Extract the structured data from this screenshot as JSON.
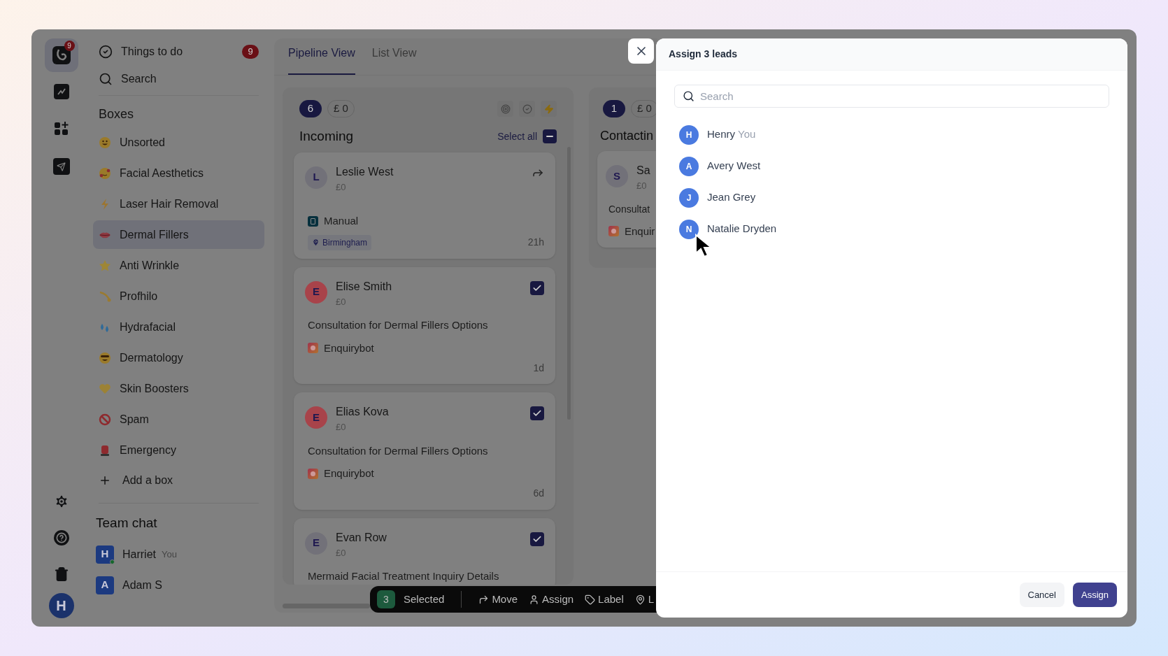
{
  "rail": {
    "logo_badge": "9"
  },
  "sidebar": {
    "things_to_do": {
      "label": "Things to do",
      "count": "9"
    },
    "search": {
      "label": "Search"
    },
    "boxes_title": "Boxes",
    "boxes": [
      {
        "label": "Unsorted",
        "selected": false
      },
      {
        "label": "Facial Aesthetics",
        "selected": false
      },
      {
        "label": "Laser Hair Removal",
        "selected": false
      },
      {
        "label": "Dermal Fillers",
        "selected": true
      },
      {
        "label": "Anti Wrinkle",
        "selected": false
      },
      {
        "label": "Profhilo",
        "selected": false
      },
      {
        "label": "Hydrafacial",
        "selected": false
      },
      {
        "label": "Dermatology",
        "selected": false
      },
      {
        "label": "Skin Boosters",
        "selected": false
      },
      {
        "label": "Spam",
        "selected": false
      },
      {
        "label": "Emergency",
        "selected": false
      }
    ],
    "add_box": "Add a box",
    "team_chat_title": "Team chat",
    "team": [
      {
        "initial": "H",
        "name": "Harriet",
        "tag": "You",
        "online": true
      },
      {
        "initial": "A",
        "name": "Adam S",
        "online": false
      }
    ],
    "user_initial": "H"
  },
  "tabs": [
    {
      "label": "Pipeline View",
      "selected": true
    },
    {
      "label": "List View",
      "selected": false
    }
  ],
  "columns": [
    {
      "count": "6",
      "value": "£ 0",
      "title": "Incoming",
      "select_all": {
        "label": "Select all",
        "indeterminate": true
      },
      "cards": [
        {
          "initial": "L",
          "color": "#727179",
          "name": "Leslie West",
          "amount": "£0",
          "checked": false,
          "source": {
            "label": "Manual",
            "kind": "manual"
          },
          "location": "Birmingham",
          "time": "21h"
        },
        {
          "initial": "E",
          "color": "#a8434a",
          "name": "Elise Smith",
          "amount": "£0",
          "checked": true,
          "title": "Consultation for Dermal Fillers Options",
          "source": {
            "label": "Enquirybot",
            "kind": "bot"
          },
          "time": "1d"
        },
        {
          "initial": "E",
          "color": "#a8434a",
          "name": "Elias Kova",
          "amount": "£0",
          "checked": true,
          "title": "Consultation for Dermal Fillers Options",
          "source": {
            "label": "Enquirybot",
            "kind": "bot"
          },
          "time": "6d"
        },
        {
          "initial": "E",
          "color": "#727179",
          "name": "Evan Row",
          "amount": "£0",
          "checked": true,
          "title": "Mermaid Facial Treatment Inquiry Details"
        }
      ]
    },
    {
      "count": "1",
      "value": "£ 0",
      "title": "Contactin",
      "cards": [
        {
          "initial": "S",
          "color": "#727179",
          "name": "Sa",
          "amount": "£0",
          "title": "Consultat",
          "source": {
            "label": "Enquir",
            "kind": "bot"
          }
        }
      ]
    }
  ],
  "action_bar": {
    "count": "3",
    "label": "Selected",
    "actions": [
      {
        "label": "Move",
        "kind": "move"
      },
      {
        "label": "Assign",
        "kind": "assign"
      },
      {
        "label": "Label",
        "kind": "label"
      },
      {
        "label": "L",
        "kind": "location"
      }
    ]
  },
  "modal": {
    "title": "Assign 3 leads",
    "search": {
      "placeholder": "Search"
    },
    "people": [
      {
        "initial": "H",
        "name": "Henry",
        "tag": "You"
      },
      {
        "initial": "A",
        "name": "Avery West"
      },
      {
        "initial": "J",
        "name": "Jean Grey"
      },
      {
        "initial": "N",
        "name": "Natalie Dryden"
      }
    ],
    "buttons": [
      {
        "label": "Cancel",
        "kind": "secondary"
      },
      {
        "label": "Assign",
        "kind": "primary"
      }
    ]
  }
}
